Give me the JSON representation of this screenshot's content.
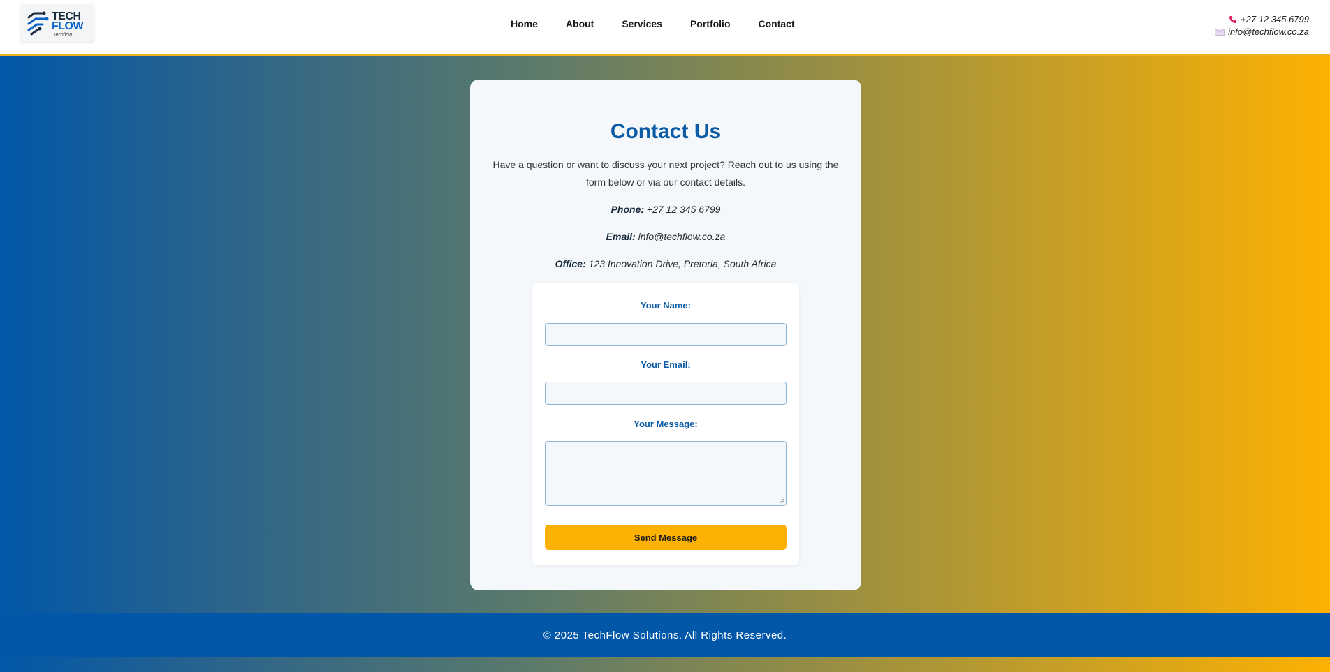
{
  "logo": {
    "word1": "TECH",
    "word2": "FLOW",
    "small": "Techflow",
    "icon": "circuit-logo-icon"
  },
  "nav": {
    "items": [
      "Home",
      "About",
      "Services",
      "Portfolio",
      "Contact"
    ]
  },
  "header_contact": {
    "phone": "+27 12 345 6799",
    "email": "info@techflow.co.za",
    "phone_icon": "phone-icon",
    "email_icon": "envelope-icon"
  },
  "contact": {
    "title": "Contact Us",
    "intro": "Have a question or want to discuss your next project? Reach out to us using the form below or via our contact details.",
    "phone_label": "Phone:",
    "phone_value": "+27 12 345 6799",
    "email_label": "Email:",
    "email_value": "info@techflow.co.za",
    "office_label": "Office:",
    "office_value": "123 Innovation Drive, Pretoria, South Africa"
  },
  "form": {
    "name_label": "Your Name:",
    "name_value": "",
    "email_label": "Your Email:",
    "email_value": "",
    "message_label": "Your Message:",
    "message_value": "",
    "submit_label": "Send Message"
  },
  "footer": {
    "text": "© 2025 TechFlow Solutions. All Rights Reserved."
  },
  "colors": {
    "brand_blue": "#0257a8",
    "accent_yellow": "#fdb102",
    "heading_blue": "#0a5aa5"
  }
}
